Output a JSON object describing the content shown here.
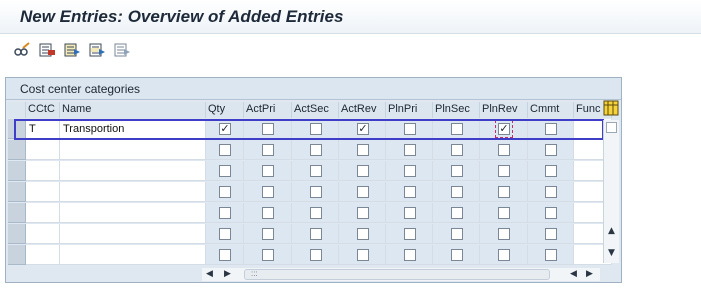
{
  "window": {
    "title": "New Entries: Overview of Added Entries"
  },
  "toolbar": {
    "buttons": [
      {
        "name": "toggle-edit-button",
        "icon": "glasses-pencil-icon"
      },
      {
        "name": "delete-button",
        "icon": "delete-rows-icon"
      },
      {
        "name": "select-all-button",
        "icon": "select-all-icon"
      },
      {
        "name": "select-block-button",
        "icon": "select-block-icon"
      },
      {
        "name": "deselect-all-button",
        "icon": "deselect-all-icon"
      }
    ]
  },
  "table": {
    "title": "Cost center categories",
    "columns": [
      "CCtC",
      "Name",
      "Qty",
      "ActPri",
      "ActSec",
      "ActRev",
      "PlnPri",
      "PlnSec",
      "PlnRev",
      "Cmmt",
      "Func"
    ],
    "rows": [
      {
        "cctc": "T",
        "name": "Transportion",
        "checks": [
          true,
          false,
          false,
          true,
          false,
          false,
          true,
          false,
          null
        ]
      },
      {
        "cctc": "",
        "name": "",
        "checks": [
          false,
          false,
          false,
          false,
          false,
          false,
          false,
          false,
          null
        ]
      },
      {
        "cctc": "",
        "name": "",
        "checks": [
          false,
          false,
          false,
          false,
          false,
          false,
          false,
          false,
          null
        ]
      },
      {
        "cctc": "",
        "name": "",
        "checks": [
          false,
          false,
          false,
          false,
          false,
          false,
          false,
          false,
          null
        ]
      },
      {
        "cctc": "",
        "name": "",
        "checks": [
          false,
          false,
          false,
          false,
          false,
          false,
          false,
          false,
          null
        ]
      },
      {
        "cctc": "",
        "name": "",
        "checks": [
          false,
          false,
          false,
          false,
          false,
          false,
          false,
          false,
          null
        ]
      },
      {
        "cctc": "",
        "name": "",
        "checks": [
          false,
          false,
          false,
          false,
          false,
          false,
          false,
          false,
          null
        ]
      }
    ]
  },
  "colors": {
    "highlight_border": "#3e3ec9",
    "check_column_bg": "#dce7f1",
    "title_color": "#1e2a3a"
  }
}
